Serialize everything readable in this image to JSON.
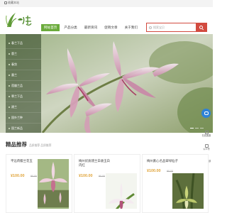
{
  "topbar": {
    "home_label": "收藏本站"
  },
  "header": {
    "logo_text": "兰之乡"
  },
  "nav": [
    {
      "label": "网站首页"
    },
    {
      "label": "产品分类"
    },
    {
      "label": "最新资讯"
    },
    {
      "label": "促销文章"
    },
    {
      "label": "关于我们"
    }
  ],
  "search": {
    "placeholder": "搜索宝贝"
  },
  "sidebar": [
    {
      "label": "春兰下品"
    },
    {
      "label": "蕙兰"
    },
    {
      "label": "春剑"
    },
    {
      "label": "墨兰"
    },
    {
      "label": "莲瓣兰品"
    },
    {
      "label": "寒兰下品"
    },
    {
      "label": "建兰"
    },
    {
      "label": "国外兰种"
    },
    {
      "label": "国兰新品"
    }
  ],
  "float_bar": [
    {
      "label": "在线客服"
    },
    {
      "label": "公众号"
    },
    {
      "label": "返回顶部"
    }
  ],
  "section": {
    "title": "精品推荐",
    "subtitle": "品质推荐 品质推荐"
  },
  "products": [
    {
      "name": "平远荷瓣兰花玉",
      "price": "¥100.00",
      "old_price": "¥0.00"
    },
    {
      "name": "梅州优质建兰白收玉白内红",
      "price": "¥100.00",
      "old_price": "¥0.00"
    },
    {
      "name": "梅州素心名品翠绿仙子",
      "price": "¥100.00",
      "old_price": "¥0.00"
    }
  ],
  "colors": {
    "accent_green": "#6bab3c",
    "search_red": "#d24a3f",
    "price_orange": "#e0a43a",
    "chat_blue": "#2e82d6"
  }
}
